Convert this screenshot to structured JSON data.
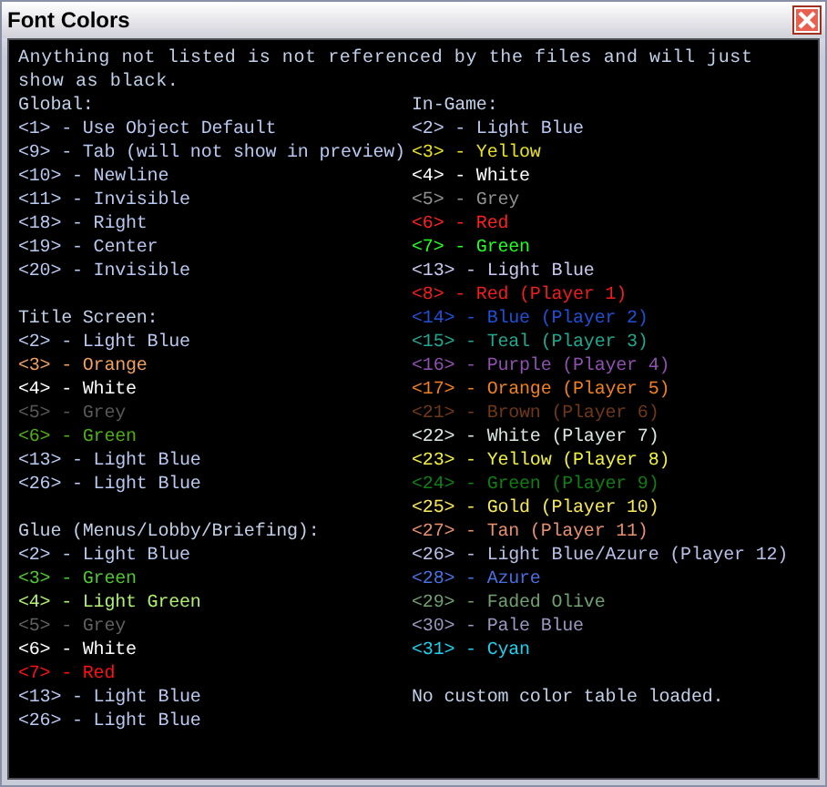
{
  "window": {
    "title": "Font Colors"
  },
  "intro": "Anything not listed is not referenced by the files and will just show as black.",
  "columns": [
    {
      "sections": [
        {
          "heading": "Global:",
          "entries": [
            {
              "text": "<1> - Use Object Default",
              "color": "#b8c8f0"
            },
            {
              "text": "<9> - Tab (will not show in preview)",
              "color": "#b8c8f0"
            },
            {
              "text": "<10> - Newline",
              "color": "#b8c8f0"
            },
            {
              "text": "<11> - Invisible",
              "color": "#b8c8f0"
            },
            {
              "text": "<18> - Right",
              "color": "#b8c8f0"
            },
            {
              "text": "<19> - Center",
              "color": "#b8c8f0"
            },
            {
              "text": "<20> - Invisible",
              "color": "#b8c8f0"
            }
          ]
        },
        {
          "heading": "Title Screen:",
          "entries": [
            {
              "text": "<2> - Light Blue",
              "color": "#b8c8f0"
            },
            {
              "text": "<3> - Orange",
              "color": "#f0a060"
            },
            {
              "text": "<4> - White",
              "color": "#ffffff"
            },
            {
              "text": "<5> - Grey",
              "color": "#585858"
            },
            {
              "text": "<6> - Green",
              "color": "#50b010"
            },
            {
              "text": "<13> - Light Blue",
              "color": "#b8c8f0"
            },
            {
              "text": "<26> - Light Blue",
              "color": "#b8c8f0"
            }
          ]
        },
        {
          "heading": "Glue (Menus/Lobby/Briefing):",
          "entries": [
            {
              "text": "<2> - Light Blue",
              "color": "#b8c8f0"
            },
            {
              "text": "<3> - Green",
              "color": "#50c830"
            },
            {
              "text": "<4> - Light Green",
              "color": "#b0f070"
            },
            {
              "text": "<5> - Grey",
              "color": "#606060"
            },
            {
              "text": "<6> - White",
              "color": "#ffffff"
            },
            {
              "text": "<7> - Red",
              "color": "#ff1010"
            },
            {
              "text": "<13> - Light Blue",
              "color": "#b8c8f0"
            },
            {
              "text": "<26> - Light Blue",
              "color": "#b8c8f0"
            }
          ]
        }
      ]
    },
    {
      "sections": [
        {
          "heading": "In-Game:",
          "entries": [
            {
              "text": "<2> - Light Blue",
              "color": "#b8c8f0"
            },
            {
              "text": "<3> - Yellow",
              "color": "#e8e020"
            },
            {
              "text": "<4> - White",
              "color": "#ffffff"
            },
            {
              "text": "<5> - Grey",
              "color": "#909090"
            },
            {
              "text": "<6> - Red",
              "color": "#ff2020"
            },
            {
              "text": "<7> - Green",
              "color": "#20ff20"
            },
            {
              "text": "<13> - Light Blue",
              "color": "#c8c8f0"
            },
            {
              "text": "<8> - Red (Player 1)",
              "color": "#f41c1c"
            },
            {
              "text": "<14> - Blue (Player 2)",
              "color": "#2050d8"
            },
            {
              "text": "<15> - Teal (Player 3)",
              "color": "#20a890"
            },
            {
              "text": "<16> - Purple (Player 4)",
              "color": "#9050b0"
            },
            {
              "text": "<17> - Orange (Player 5)",
              "color": "#f08020"
            },
            {
              "text": "<21> - Brown (Player 6)",
              "color": "#703818"
            },
            {
              "text": "<22> - White (Player 7)",
              "color": "#d8e8e0"
            },
            {
              "text": "<23> - Yellow (Player 8)",
              "color": "#f0f040"
            },
            {
              "text": "<24> - Green (Player 9)",
              "color": "#0c8010"
            },
            {
              "text": "<25> - Gold (Player 10)",
              "color": "#f8e858"
            },
            {
              "text": "<27> - Tan (Player 11)",
              "color": "#e89070"
            },
            {
              "text": "<26> - Light Blue/Azure (Player 12)",
              "color": "#b8c0e8"
            },
            {
              "text": "<28> - Azure",
              "color": "#4870e0"
            },
            {
              "text": "<29> - Faded Olive",
              "color": "#70a070"
            },
            {
              "text": "<30> - Pale Blue",
              "color": "#9898c0"
            },
            {
              "text": "<31> - Cyan",
              "color": "#20d0f0"
            }
          ]
        }
      ],
      "note": "No custom color table loaded."
    }
  ]
}
